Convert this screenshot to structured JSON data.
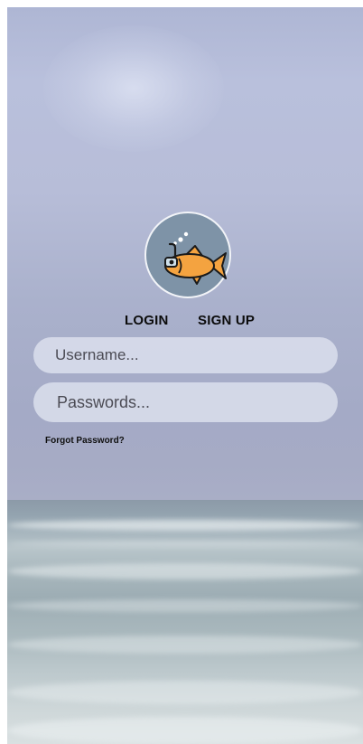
{
  "auth": {
    "login_tab": "LOGIN",
    "signup_tab": "SIGN UP",
    "username_placeholder": "Username...",
    "password_placeholder": "Passwords...",
    "forgot_password": "Forgot Password?"
  },
  "logo": {
    "icon": "fish-snorkel-icon",
    "circle_color": "#7e93a7",
    "fish_color": "#f4a340"
  },
  "background": {
    "icon": "beach-ocean-photo"
  }
}
